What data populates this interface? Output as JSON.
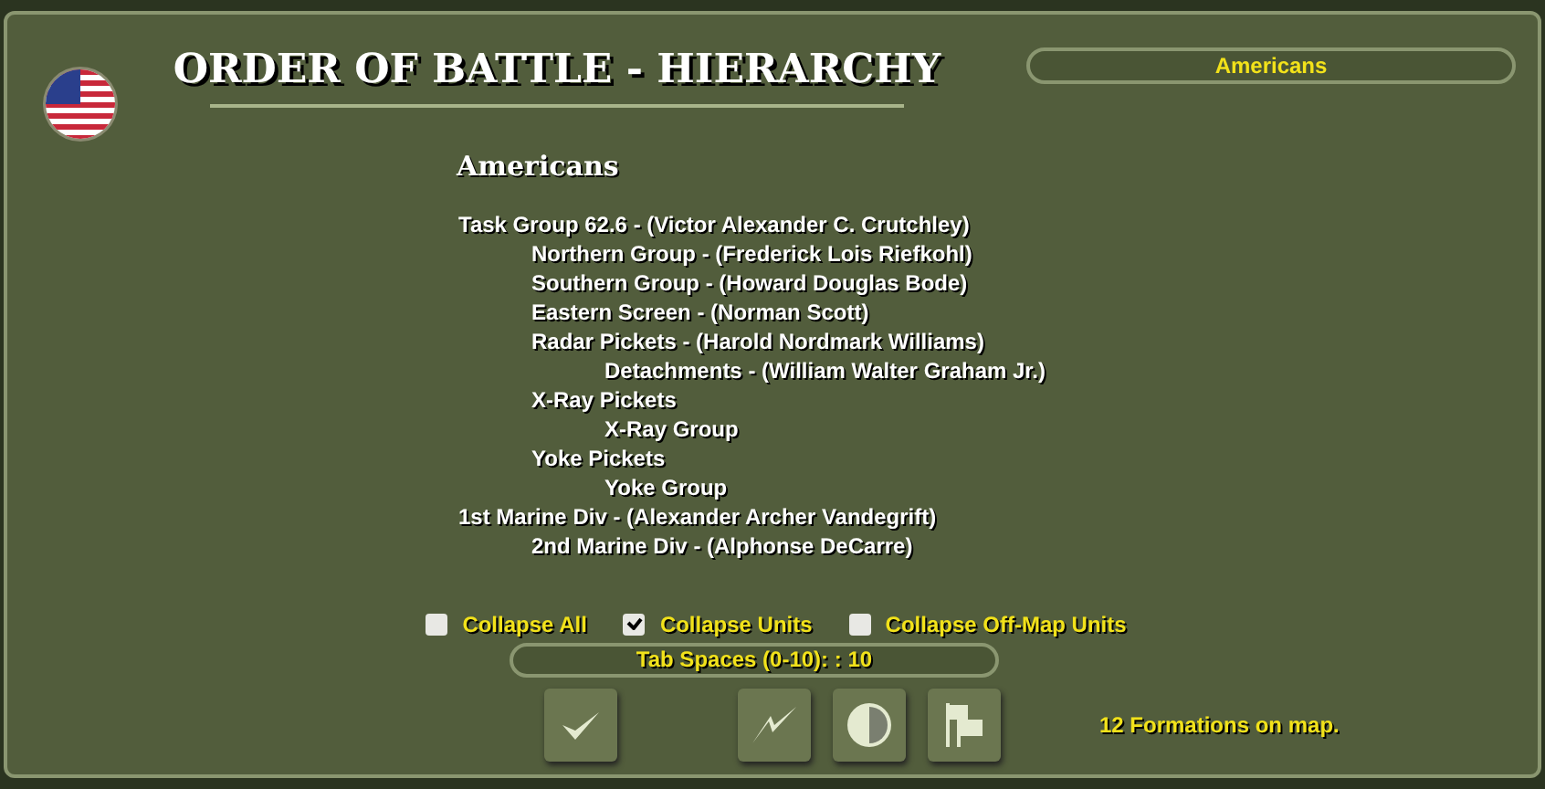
{
  "title": "ORDER OF BATTLE - HIERARCHY",
  "side_selector": {
    "label": "Americans"
  },
  "subtitle": "Americans",
  "tree": [
    {
      "label": "Task Group 62.6 - (Victor Alexander C. Crutchley)",
      "children": [
        {
          "label": "Northern Group - (Frederick Lois Riefkohl)"
        },
        {
          "label": "Southern Group - (Howard Douglas Bode)"
        },
        {
          "label": "Eastern Screen - (Norman Scott)"
        },
        {
          "label": "Radar Pickets - (Harold Nordmark Williams)",
          "children": [
            {
              "label": "Detachments - (William Walter Graham Jr.)"
            }
          ]
        },
        {
          "label": "X-Ray Pickets",
          "children": [
            {
              "label": "X-Ray Group"
            }
          ]
        },
        {
          "label": "Yoke Pickets",
          "children": [
            {
              "label": "Yoke Group"
            }
          ]
        }
      ]
    },
    {
      "label": "1st Marine Div - (Alexander Archer Vandegrift)",
      "children": [
        {
          "label": "2nd Marine Div - (Alphonse DeCarre)"
        }
      ]
    }
  ],
  "options": [
    {
      "label": "Collapse All",
      "checked": false
    },
    {
      "label": "Collapse Units",
      "checked": true
    },
    {
      "label": "Collapse Off-Map Units",
      "checked": false
    }
  ],
  "tab_spaces": {
    "label": "Tab Spaces (0-10): : 10"
  },
  "buttons": [
    {
      "kind": "check"
    },
    {
      "kind": "spacer"
    },
    {
      "kind": "zigzag"
    },
    {
      "kind": "contrast"
    },
    {
      "kind": "flags"
    }
  ],
  "status": "12 Formations on map."
}
